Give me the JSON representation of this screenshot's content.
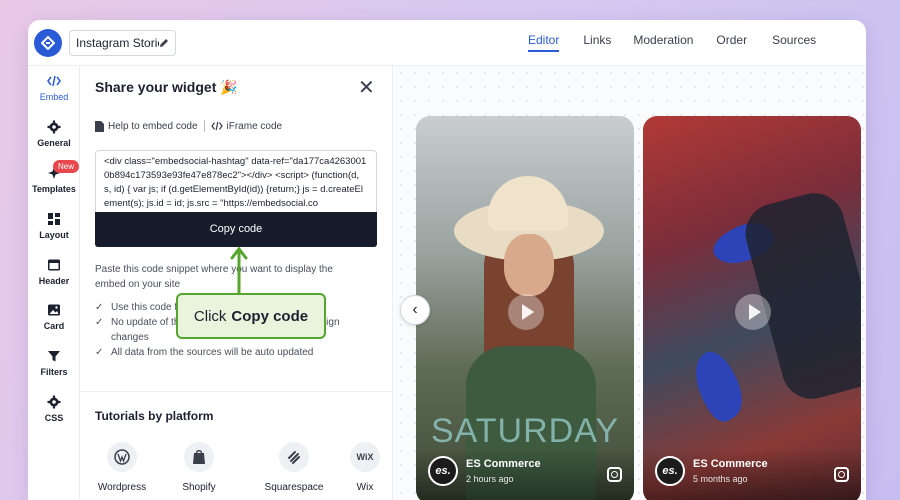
{
  "header": {
    "widget_title": "Instagram Storie...",
    "tabs": [
      {
        "label": "Editor",
        "active": true
      },
      {
        "label": "Links"
      },
      {
        "label": "Moderation"
      },
      {
        "label": "Order"
      },
      {
        "label": "Sources"
      }
    ]
  },
  "sidebar": {
    "items": [
      {
        "label": "Embed",
        "icon": "code-icon",
        "active": true
      },
      {
        "label": "General",
        "icon": "gear-icon"
      },
      {
        "label": "Templates",
        "icon": "sparkle-icon",
        "badge": "New"
      },
      {
        "label": "Layout",
        "icon": "layout-icon"
      },
      {
        "label": "Header",
        "icon": "header-icon"
      },
      {
        "label": "Card",
        "icon": "image-icon"
      },
      {
        "label": "Filters",
        "icon": "filter-icon"
      },
      {
        "label": "CSS",
        "icon": "gear-icon"
      }
    ]
  },
  "panel": {
    "title": "Share your widget 🎉",
    "help_link": "Help to embed code",
    "iframe_link": "iFrame code",
    "code_snippet": "<div class=\"embedsocial-hashtag\" data-ref=\"da177ca42630010b894c173593e93fe47e878ec2\"></div> <script> (function(d, s, id) { var js; if (d.getElementById(id)) {return;} js = d.createElement(s); js.id = id; js.src = \"https://embedsocial.co",
    "copy_button": "Copy code",
    "paste_text": "Paste this code snippet where you want to display the embed on your site",
    "checks": [
      "Use this code for mobile, tablet and desktop",
      "No update of the code needed when making design changes",
      "All data from the sources will be auto updated"
    ],
    "tutorials_title": "Tutorials by platform",
    "platforms": [
      {
        "label": "Wordpress",
        "icon": "wordpress-icon"
      },
      {
        "label": "Shopify",
        "icon": "shopify-icon"
      },
      {
        "label": "Squarespace",
        "icon": "squarespace-icon"
      },
      {
        "label": "Wix",
        "icon": "wix-icon",
        "glyph": "WiX"
      }
    ]
  },
  "callout": {
    "prefix": "Click",
    "bold": "Copy code"
  },
  "preview": {
    "cards": [
      {
        "author": "ES Commerce",
        "time": "2 hours ago",
        "overlay_text": "SATURDAY",
        "avatar_text": "es."
      },
      {
        "author": "ES Commerce",
        "time": "5 months ago",
        "avatar_text": "es."
      }
    ]
  },
  "colors": {
    "accent": "#2a5bd7",
    "copy_button_bg": "#161c2c",
    "callout_border": "#55a530",
    "badge": "#e8474d"
  }
}
